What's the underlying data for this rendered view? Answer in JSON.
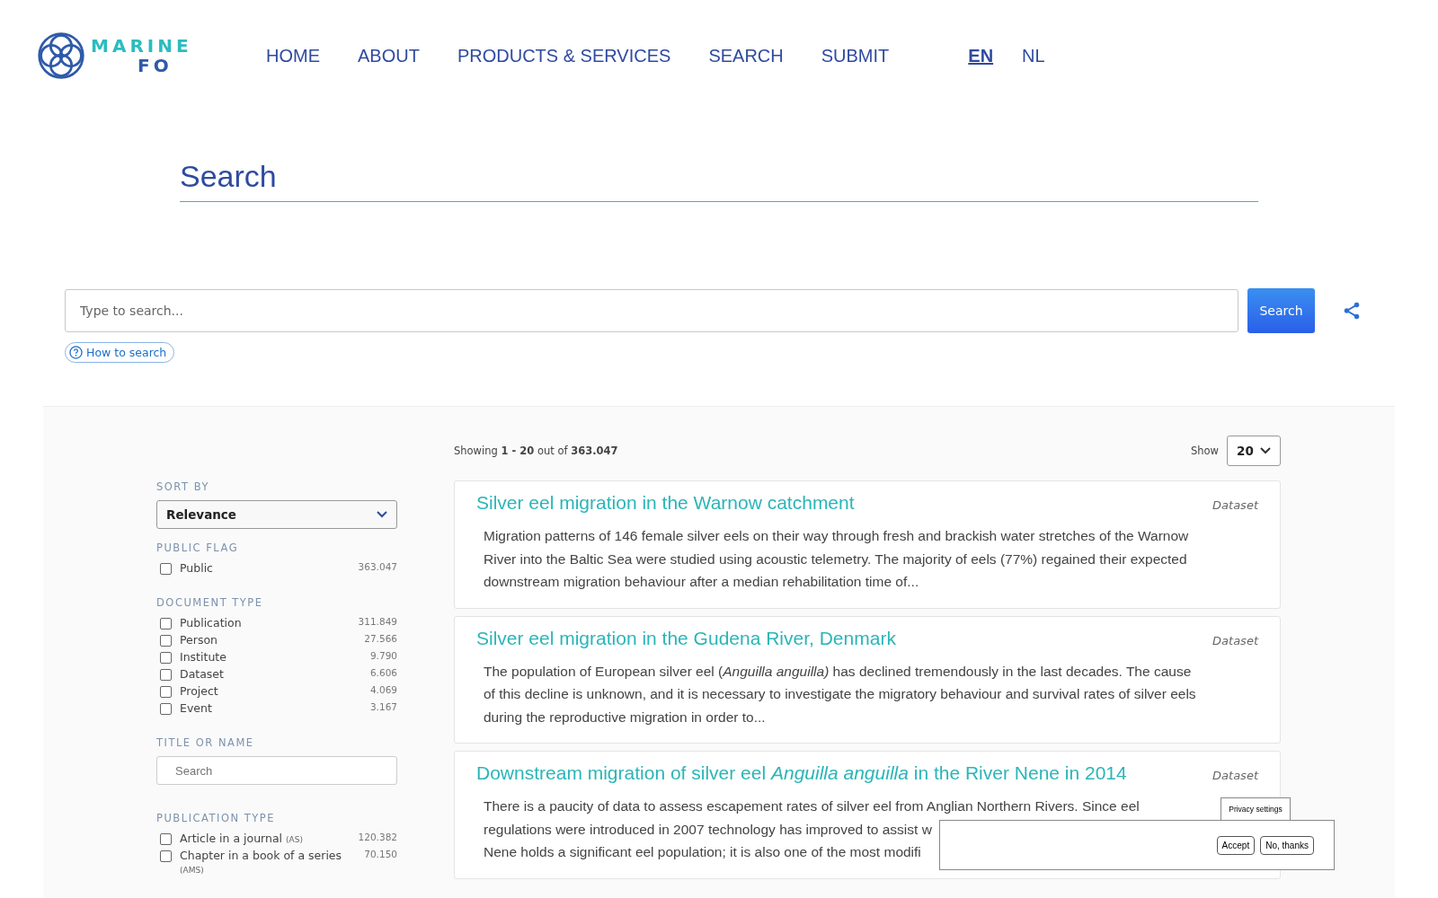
{
  "logo": {
    "line1": "MARINE",
    "line2": "FO"
  },
  "nav": [
    {
      "label": "HOME",
      "selected": false
    },
    {
      "label": "ABOUT",
      "selected": false
    },
    {
      "label": "PRODUCTS & SERVICES",
      "selected": false
    },
    {
      "label": "SEARCH",
      "selected": false
    },
    {
      "label": "SUBMIT",
      "selected": false
    }
  ],
  "languages": [
    {
      "label": "EN",
      "selected": true
    },
    {
      "label": "NL",
      "selected": false
    }
  ],
  "page_title": "Search",
  "search": {
    "placeholder": "Type to search...",
    "button": "Search",
    "help_link": "How to search"
  },
  "sidebar": {
    "sort": {
      "label": "SORT BY",
      "value": "Relevance"
    },
    "facets": [
      {
        "kind": "checkboxes",
        "label": "PUBLIC FLAG",
        "items": [
          {
            "label": "Public",
            "count": "363.047",
            "checked": false
          }
        ]
      },
      {
        "kind": "checkboxes",
        "label": "DOCUMENT TYPE",
        "items": [
          {
            "label": "Publication",
            "count": "311.849",
            "checked": false
          },
          {
            "label": "Person",
            "count": "27.566",
            "checked": false
          },
          {
            "label": "Institute",
            "count": "9.790",
            "checked": false
          },
          {
            "label": "Dataset",
            "count": "6.606",
            "checked": false
          },
          {
            "label": "Project",
            "count": "4.069",
            "checked": false
          },
          {
            "label": "Event",
            "count": "3.167",
            "checked": false
          }
        ]
      },
      {
        "kind": "field",
        "label": "TITLE OR NAME",
        "placeholder": "Search"
      },
      {
        "kind": "checkboxes",
        "label": "PUBLICATION TYPE",
        "items": [
          {
            "label": "Article in a journal",
            "code": "(AS)",
            "count": "120.382",
            "checked": false
          },
          {
            "label": "Chapter in a book of a series",
            "code": "(AMS)",
            "count": "70.150",
            "checked": false
          }
        ]
      }
    ]
  },
  "results_summary": "Showing **1 - 20** out of **363.047**",
  "page_size": {
    "label": "Show",
    "value": "20"
  },
  "results": [
    {
      "title": "Silver eel migration in the Warnow catchment",
      "type": "Dataset",
      "abstract_lines": [
        "Migration patterns of 146 female silver eels on their way through fresh and brackish water stretches of the Warnow",
        "River into the Baltic Sea were studied using acoustic telemetry. The majority of eels (77%) regained their expected",
        "downstream migration behaviour after a median rehabilitation time of..."
      ]
    },
    {
      "title": "Silver eel migration in the Gudena River, Denmark",
      "type": "Dataset",
      "abstract_lines": [
        "The population of European silver eel (*Anguilla anguilla)* has declined tremendously in the last decades. The cause",
        "of this decline is unknown, and it is necessary to investigate the migratory behaviour and survival rates of silver eels",
        "during the reproductive migration in order to..."
      ]
    },
    {
      "title": "Downstream migration of silver eel *Anguilla anguilla* in the River Nene in 2014",
      "type": "Dataset",
      "abstract_lines": [
        "There is a paucity of data to assess escapement rates of silver eel from Anglian Northern Rivers. Since eel",
        "regulations were introduced in 2007 technology has improved to assist w",
        "Nene holds a significant eel population; it is also one of the most modifi"
      ]
    }
  ],
  "privacy": {
    "tab": "Privacy settings",
    "buttons": [
      "Accept",
      "No, thanks"
    ]
  }
}
